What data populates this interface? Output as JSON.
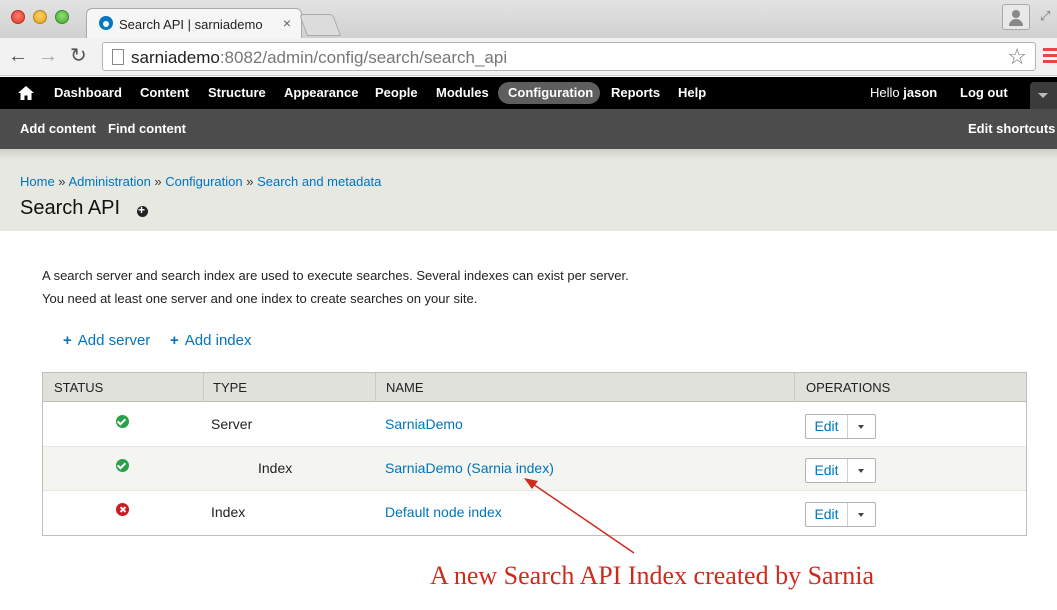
{
  "browser": {
    "tab_title": "Search API | sarniademo",
    "tab_close": "×",
    "url_host": "sarniademo",
    "url_path": ":8082/admin/config/search/search_api"
  },
  "admin_menu": {
    "items": [
      "Dashboard",
      "Content",
      "Structure",
      "Appearance",
      "People",
      "Modules",
      "Configuration",
      "Reports",
      "Help"
    ],
    "active": "Configuration",
    "greeting": "Hello",
    "username": "jason",
    "logout": "Log out"
  },
  "shortcuts": {
    "items": [
      "Add content",
      "Find content"
    ],
    "edit": "Edit shortcuts"
  },
  "breadcrumb": [
    "Home",
    "Administration",
    "Configuration",
    "Search and metadata"
  ],
  "page_title": "Search API",
  "description": [
    "A search server and search index are used to execute searches. Several indexes can exist per server.",
    "You need at least one server and one index to create searches on your site."
  ],
  "actions": [
    "Add server",
    "Add index"
  ],
  "table": {
    "headers": [
      "STATUS",
      "TYPE",
      "NAME",
      "OPERATIONS"
    ],
    "rows": [
      {
        "status": "enabled",
        "type": "Server",
        "name": "SarniaDemo",
        "op": "Edit"
      },
      {
        "status": "enabled",
        "type": "Index",
        "name": "SarniaDemo (Sarnia index)",
        "op": "Edit"
      },
      {
        "status": "disabled",
        "type": "Index",
        "name": "Default node index",
        "op": "Edit"
      }
    ]
  },
  "annotation": "A new Search API Index created by Sarnia",
  "colors": {
    "link": "#0074bd",
    "annotation": "#d02a1f",
    "enabled": "#2aa149",
    "disabled": "#c91c21"
  }
}
